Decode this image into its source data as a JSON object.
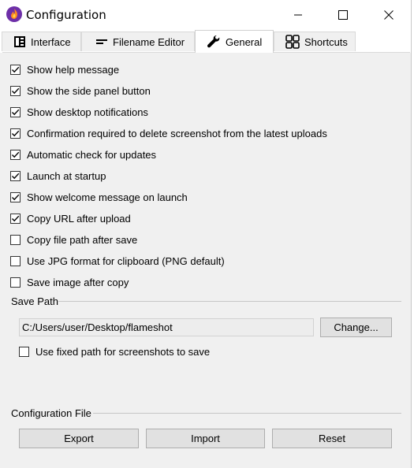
{
  "window": {
    "title": "Configuration"
  },
  "tabs": [
    {
      "label": "Interface",
      "icon": "interface-icon",
      "active": false
    },
    {
      "label": "Filename Editor",
      "icon": "filename-editor-icon",
      "active": false
    },
    {
      "label": "General",
      "icon": "wrench-icon",
      "active": true
    },
    {
      "label": "Shortcuts",
      "icon": "shortcuts-grid-icon",
      "active": false
    }
  ],
  "general": {
    "options": [
      {
        "label": "Show help message",
        "checked": true
      },
      {
        "label": "Show the side panel button",
        "checked": true
      },
      {
        "label": "Show desktop notifications",
        "checked": true
      },
      {
        "label": "Confirmation required to delete screenshot from the latest uploads",
        "checked": true
      },
      {
        "label": "Automatic check for updates",
        "checked": true
      },
      {
        "label": "Launch at startup",
        "checked": true
      },
      {
        "label": "Show welcome message on launch",
        "checked": true
      },
      {
        "label": "Copy URL after upload",
        "checked": true
      },
      {
        "label": "Copy file path after save",
        "checked": false
      },
      {
        "label": "Use JPG format for clipboard (PNG default)",
        "checked": false
      },
      {
        "label": "Save image after copy",
        "checked": false
      }
    ],
    "save_path": {
      "group_title": "Save Path",
      "value": "C:/Users/user/Desktop/flameshot",
      "change_label": "Change...",
      "fixed_path_label": "Use fixed path for screenshots to save",
      "fixed_path_checked": false
    },
    "config_file": {
      "group_title": "Configuration File",
      "export_label": "Export",
      "import_label": "Import",
      "reset_label": "Reset"
    }
  },
  "colors": {
    "window_bg": "#f0f0f0",
    "titlebar_bg": "#ffffff",
    "button_bg": "#e1e1e1",
    "button_border": "#adadad"
  }
}
